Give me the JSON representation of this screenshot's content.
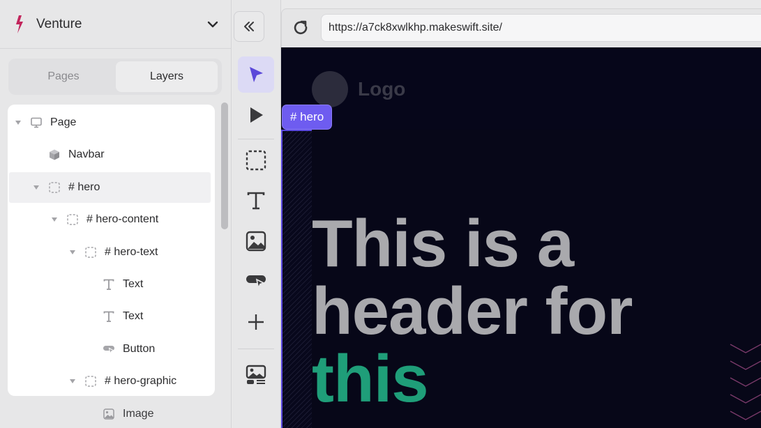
{
  "site": {
    "name": "Venture"
  },
  "left_tabs": [
    "Pages",
    "Layers"
  ],
  "layers": [
    {
      "label": "Page",
      "depth": 0,
      "icon": "monitor-icon",
      "caret": true
    },
    {
      "label": "Navbar",
      "depth": 1,
      "icon": "cube-icon",
      "caret": false
    },
    {
      "label": "# hero",
      "depth": 1,
      "icon": "box-dashed-icon",
      "caret": true,
      "selected": true
    },
    {
      "label": "# hero-content",
      "depth": 2,
      "icon": "box-dashed-icon",
      "caret": true
    },
    {
      "label": "# hero-text",
      "depth": 3,
      "icon": "box-dashed-icon",
      "caret": true
    },
    {
      "label": "Text",
      "depth": 4,
      "icon": "text-icon",
      "caret": false
    },
    {
      "label": "Text",
      "depth": 4,
      "icon": "text-icon",
      "caret": false
    },
    {
      "label": "Button",
      "depth": 4,
      "icon": "button-icon",
      "caret": false
    },
    {
      "label": "# hero-graphic",
      "depth": 3,
      "icon": "box-dashed-icon",
      "caret": true
    }
  ],
  "layers_outside": [
    {
      "label": "Image",
      "depth": 4,
      "icon": "image-icon"
    }
  ],
  "tools": [
    "pointer-icon",
    "play-icon",
    "box-select-icon",
    "text-tool-icon",
    "image-tool-icon",
    "button-tool-icon",
    "plus-icon",
    "component-icon"
  ],
  "browser": {
    "url": "https://a7ck8xwlkhp.makeswift.site/"
  },
  "canvas": {
    "logo_text": "Logo",
    "selected_badge": "# hero",
    "heading_line1": "This is a",
    "heading_line2": "header for",
    "heading_accent": "this"
  },
  "colors": {
    "brand": "#c2255c",
    "accent": "#6e5cf0",
    "hero_accent_text": "#1f9e79",
    "canvas_bg": "#06061a"
  }
}
